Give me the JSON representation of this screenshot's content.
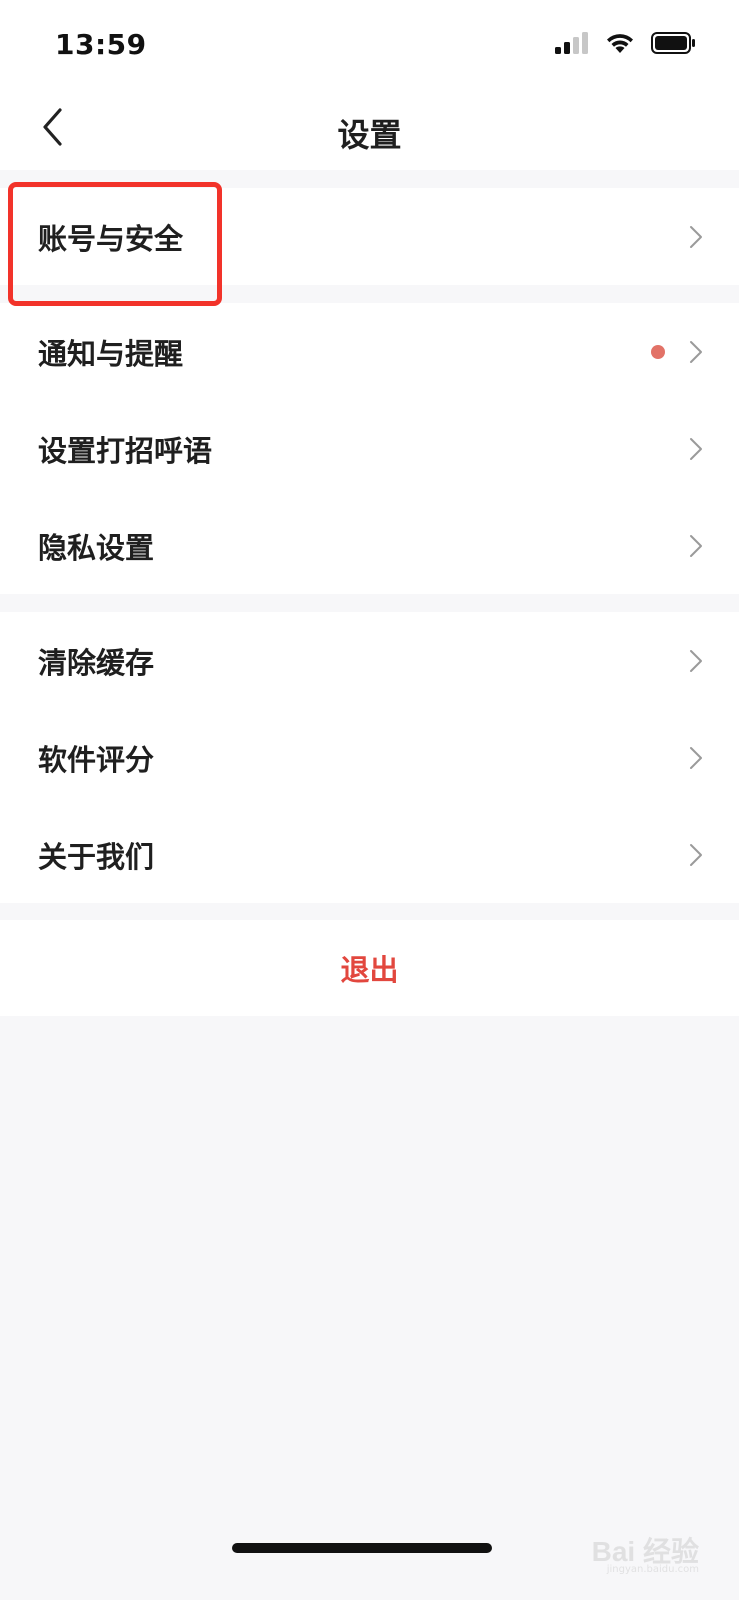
{
  "status_bar": {
    "time": "13:59",
    "icons": [
      "signal-icon",
      "wifi-icon",
      "battery-icon"
    ]
  },
  "nav": {
    "title": "设置",
    "back_icon": "chevron-left-icon"
  },
  "groups": [
    {
      "items": [
        {
          "label": "账号与安全",
          "highlighted": true,
          "badge": false
        }
      ]
    },
    {
      "items": [
        {
          "label": "通知与提醒",
          "badge": true
        },
        {
          "label": "设置打招呼语",
          "badge": false
        },
        {
          "label": "隐私设置",
          "badge": false
        }
      ]
    },
    {
      "items": [
        {
          "label": "清除缓存",
          "badge": false
        },
        {
          "label": "软件评分",
          "badge": false
        },
        {
          "label": "关于我们",
          "badge": false
        }
      ]
    }
  ],
  "logout": {
    "label": "退出"
  },
  "watermark": {
    "text": "Bai 经验",
    "sub": "jingyan.baidu.com"
  },
  "colors": {
    "accent_red": "#e2473e",
    "badge_dot": "#e27267",
    "highlight_box": "#f2332a",
    "background": "#f7f7f9"
  }
}
